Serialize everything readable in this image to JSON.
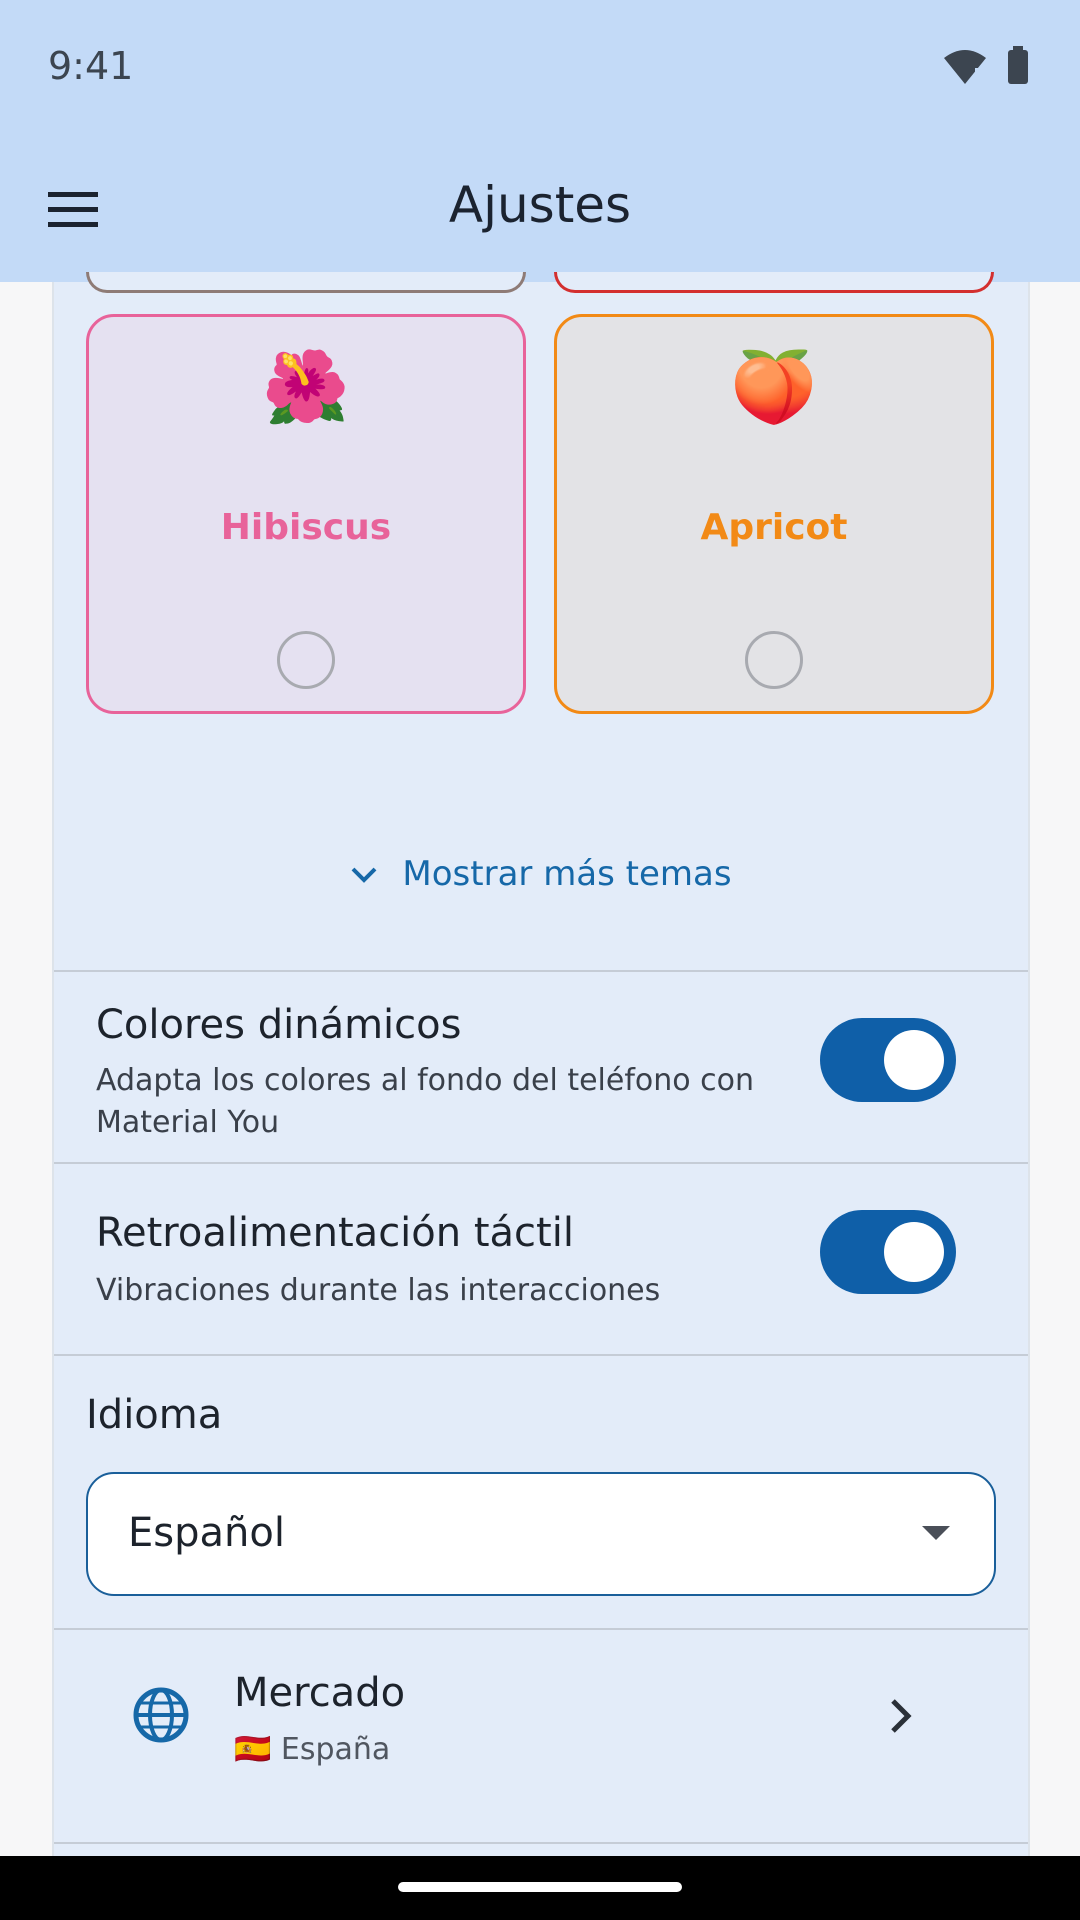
{
  "status_bar": {
    "time": "9:41",
    "icons": [
      "wifi-alert-icon",
      "battery-icon"
    ]
  },
  "app_bar": {
    "title": "Ajustes",
    "menu_icon": "menu-icon"
  },
  "themes": {
    "cards": [
      {
        "name": "Hibiscus",
        "emoji": "🌺",
        "color": "#e8639a",
        "bg": "#e5e1f1",
        "selected": false
      },
      {
        "name": "Apricot",
        "emoji": "🍑",
        "color": "#f28a16",
        "bg": "#e3e3e6",
        "selected": false
      }
    ],
    "partial_top_colors": [
      "#8e7b76",
      "#d32f2f"
    ],
    "show_more_label": "Mostrar más temas"
  },
  "settings": {
    "dynamic_colors": {
      "title": "Colores dinámicos",
      "subtitle": "Adapta los colores al fondo del teléfono con Material You",
      "enabled": true
    },
    "haptic": {
      "title": "Retroalimentación táctil",
      "subtitle": "Vibraciones durante las interacciones",
      "enabled": true
    },
    "language": {
      "label": "Idioma",
      "value": "Español"
    },
    "market": {
      "title": "Mercado",
      "value": "🇪🇸 España"
    }
  },
  "colors": {
    "accent": "#0f5fa8",
    "app_bar": "#c3daf7",
    "panel": "#e3ecf9"
  }
}
